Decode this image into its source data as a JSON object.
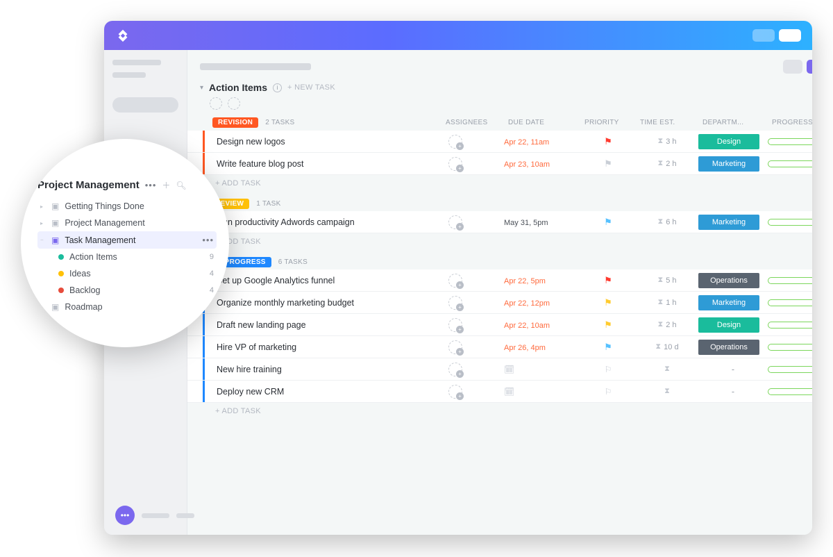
{
  "list": {
    "title": "Action Items",
    "new_task_label": "+ NEW TASK",
    "add_task_label": "+ ADD TASK"
  },
  "columns": {
    "assignees": "ASSIGNEES",
    "due": "DUE DATE",
    "priority": "PRIORITY",
    "time": "TIME EST.",
    "dept": "DEPARTM...",
    "progress": "PROGRESS"
  },
  "departments": {
    "Design": {
      "label": "Design",
      "color": "#1abc9c"
    },
    "Marketing": {
      "label": "Marketing",
      "color": "#2e9bd6"
    },
    "Operations": {
      "label": "Operations",
      "color": "#5a6470"
    }
  },
  "groups": [
    {
      "status": "REVISION",
      "color": "#ff5722",
      "count_label": "2 TASKS",
      "tasks": [
        {
          "title": "Design new logos",
          "due": "Apr 22, 11am",
          "due_color": "#ff6a3d",
          "flag_color": "#ff3b30",
          "time": "3 h",
          "dept": "Design",
          "progress": "0%"
        },
        {
          "title": "Write feature blog post",
          "due": "Apr 23, 10am",
          "due_color": "#ff6a3d",
          "flag_color": "#c9ced6",
          "time": "2 h",
          "dept": "Marketing",
          "progress": "0%"
        }
      ]
    },
    {
      "status": "REVIEW",
      "color": "#ffc107",
      "count_label": "1 TASK",
      "tasks": [
        {
          "title": "Run productivity Adwords campaign",
          "due": "May 31, 5pm",
          "due_color": "#4b5058",
          "flag_color": "#57c1ff",
          "time": "6 h",
          "dept": "Marketing",
          "progress": "0%"
        }
      ]
    },
    {
      "status": "IN PROGRESS",
      "color": "#1e88ff",
      "count_label": "6 TASKS",
      "tasks": [
        {
          "title": "Set up Google Analytics funnel",
          "due": "Apr 22, 5pm",
          "due_color": "#ff6a3d",
          "flag_color": "#ff3b30",
          "time": "5 h",
          "dept": "Operations",
          "progress": "0%"
        },
        {
          "title": "Organize monthly marketing budget",
          "due": "Apr 22, 12pm",
          "due_color": "#ff6a3d",
          "flag_color": "#ffcb2f",
          "time": "1 h",
          "dept": "Marketing",
          "progress": "0%"
        },
        {
          "title": "Draft new landing page",
          "due": "Apr 22, 10am",
          "due_color": "#ff6a3d",
          "flag_color": "#ffcb2f",
          "time": "2 h",
          "dept": "Design",
          "progress": "0%"
        },
        {
          "title": "Hire VP of marketing",
          "due": "Apr 26, 4pm",
          "due_color": "#ff6a3d",
          "flag_color": "#57c1ff",
          "time": "10 d",
          "dept": "Operations",
          "progress": "0%"
        },
        {
          "title": "New hire training",
          "due": "",
          "due_color": "",
          "flag_color": "",
          "time": "",
          "dept": "",
          "progress": "0%"
        },
        {
          "title": "Deploy new CRM",
          "due": "",
          "due_color": "",
          "flag_color": "",
          "time": "",
          "dept": "",
          "progress": "0%"
        }
      ]
    }
  ],
  "sidebar_pop": {
    "title": "Project Management",
    "items": [
      {
        "label": "Getting Things Done",
        "type": "folder"
      },
      {
        "label": "Project Management",
        "type": "folder"
      },
      {
        "label": "Task Management",
        "type": "folder",
        "active": true
      },
      {
        "label": "Action Items",
        "type": "list",
        "dot": "#1abc9c",
        "count": "9",
        "sub": true
      },
      {
        "label": "Ideas",
        "type": "list",
        "dot": "#ffc107",
        "count": "4",
        "sub": true
      },
      {
        "label": "Backlog",
        "type": "list",
        "dot": "#e74c3c",
        "count": "4",
        "sub": true
      },
      {
        "label": "Roadmap",
        "type": "folder"
      }
    ]
  }
}
